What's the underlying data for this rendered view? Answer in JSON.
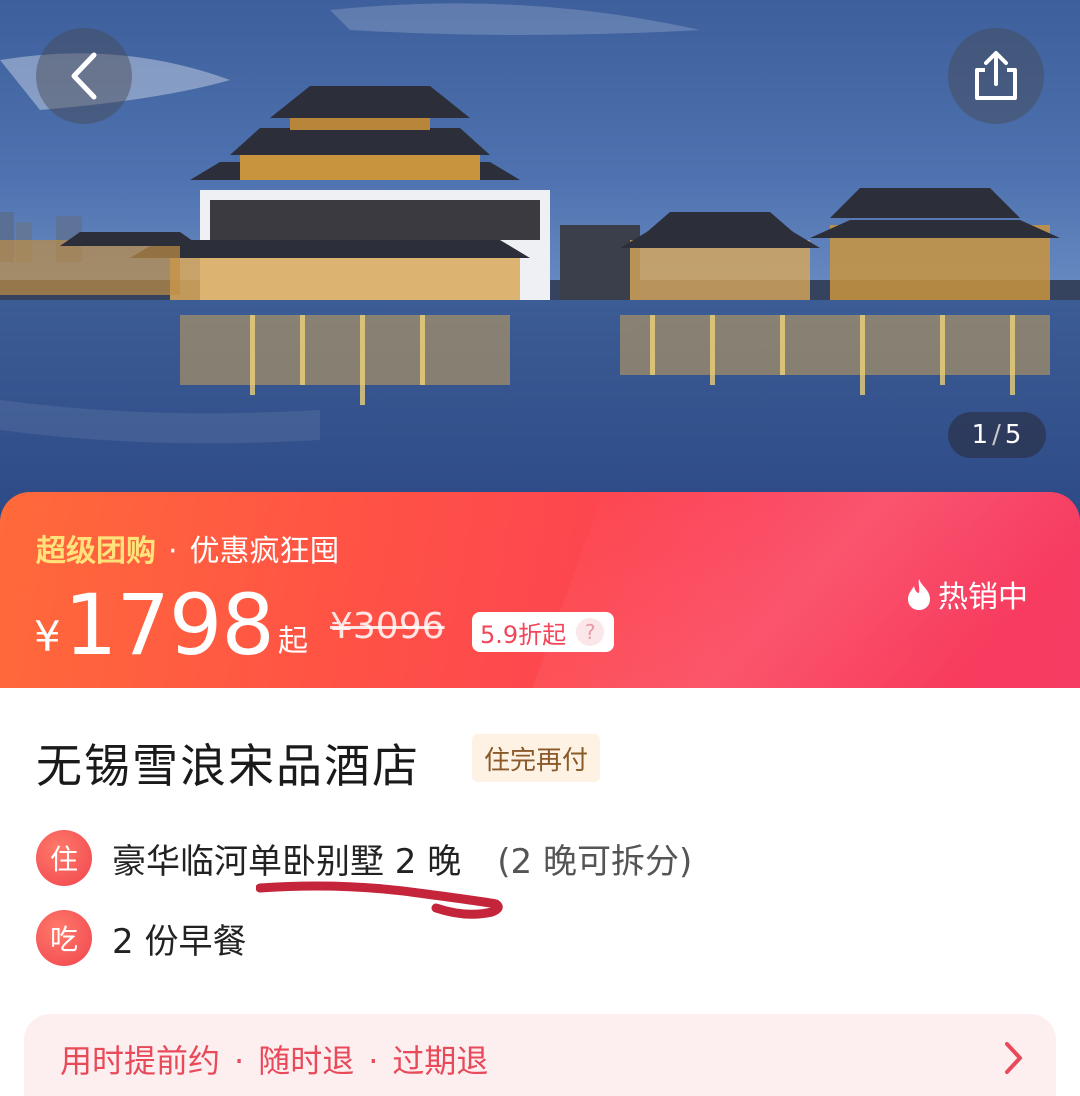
{
  "gallery": {
    "current": "1",
    "separator": "/",
    "total": "5"
  },
  "promo": {
    "tag": "超级团购",
    "separator": "·",
    "slogan": "优惠疯狂囤",
    "currency": "¥",
    "price": "1798",
    "price_suffix": "起",
    "original_price": "¥3096",
    "discount": "5.9折起",
    "discount_help": "?",
    "hot_label": "热销中"
  },
  "hotel": {
    "name": "无锡雪浪宋品酒店",
    "pay_badge": "住完再付",
    "stay_icon": "住",
    "stay_text": "豪华临河单卧别墅 2 晚",
    "stay_note": "(2 晚可拆分)",
    "eat_icon": "吃",
    "eat_text": "2 份早餐"
  },
  "policy": {
    "item1": "用时提前约",
    "sep": "·",
    "item2": "随时退",
    "item3": "过期退"
  },
  "colors": {
    "promo_start": "#ff6a3a",
    "promo_end": "#f63c62",
    "accent_yellow": "#ffe27a",
    "policy_text": "#e84a5a"
  }
}
